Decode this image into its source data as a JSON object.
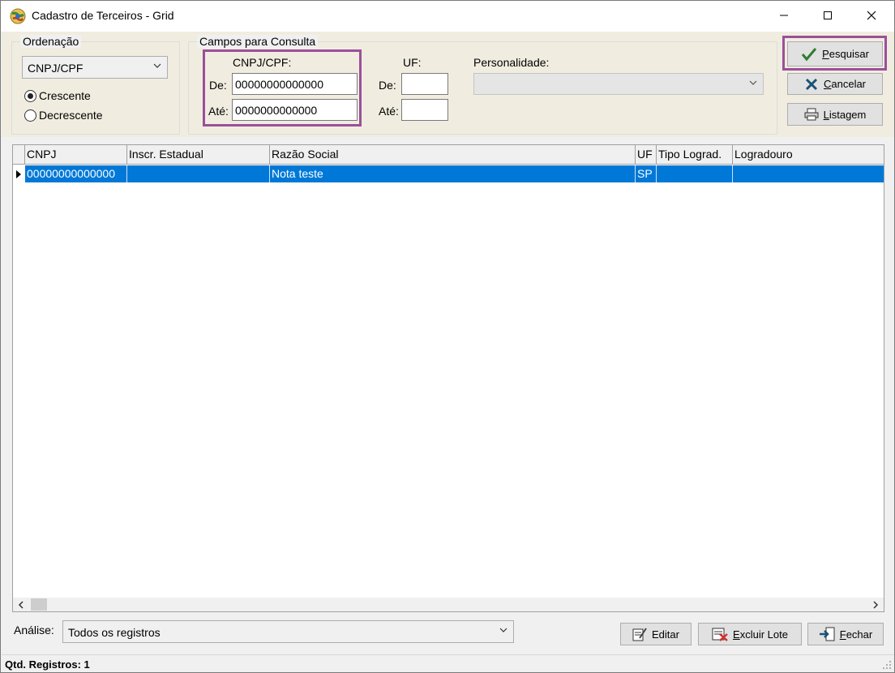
{
  "window": {
    "title": "Cadastro de Terceiros - Grid"
  },
  "ordenacao": {
    "title": "Ordenação",
    "selected": "CNPJ/CPF",
    "options": {
      "asc": "Crescente",
      "desc": "Decrescente"
    },
    "checked": "asc"
  },
  "campos": {
    "title": "Campos para Consulta",
    "cnpj_label": "CNPJ/CPF:",
    "de_label": "De:",
    "ate_label": "Até:",
    "cnpj_de": "00000000000000",
    "cnpj_ate": "0000000000000",
    "uf_label": "UF:",
    "uf_de": "",
    "uf_ate": "",
    "personalidade_label": "Personalidade:",
    "personalidade_value": ""
  },
  "buttons": {
    "pesquisar_u": "P",
    "pesquisar_rest": "esquisar",
    "cancelar_u": "C",
    "cancelar_rest": "ancelar",
    "listagem_u": "L",
    "listagem_rest": "istagem",
    "editar": "Editar",
    "excluir_u": "E",
    "excluir_rest": "xcluir Lote",
    "fechar_u": "F",
    "fechar_rest": "echar"
  },
  "grid": {
    "columns": [
      "CNPJ",
      "Inscr. Estadual",
      "Razão Social",
      "UF",
      "Tipo Lograd.",
      "Logradouro"
    ],
    "rows": [
      [
        "00000000000000",
        "",
        "Nota teste",
        "SP",
        "",
        ""
      ]
    ]
  },
  "analise": {
    "label": "Análise:",
    "value": "Todos os registros"
  },
  "status": {
    "text": "Qtd. Registros: 1"
  },
  "colors": {
    "accent": "#0078d7",
    "highlight": "#9b4f9b",
    "check": "#2e7d32",
    "cross": "#1a5276"
  },
  "icons": {
    "app": "app-globe-icon",
    "pesquisar": "check-icon",
    "cancelar": "cross-icon",
    "listagem": "printer-icon",
    "editar": "edit-icon",
    "excluir": "delete-icon",
    "fechar": "exit-icon"
  }
}
